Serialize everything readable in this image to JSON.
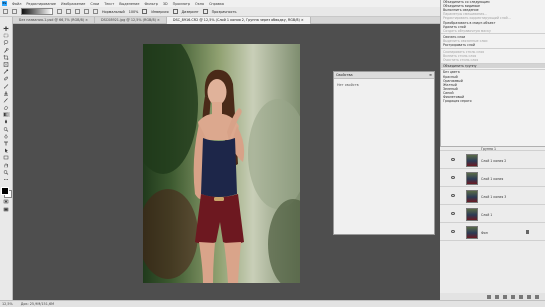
{
  "app": {
    "logo": "Ps"
  },
  "menubar": [
    "Файл",
    "Редактирование",
    "Изображение",
    "Слои",
    "Текст",
    "Выделение",
    "Фильтр",
    "3D",
    "Просмотр",
    "Окно",
    "Справка"
  ],
  "options": {
    "mode": "Нормальный",
    "opacity": "100%",
    "reverse": "Инверсия",
    "dither": "Дизеринг",
    "transparency": "Прозрачность"
  },
  "tabs": [
    {
      "label": "Без названия-1.psd @ 66,7% (RGB/8) ×"
    },
    {
      "label": "DSC08921.jpg @ 12,5% (RGB/8) ×"
    },
    {
      "label": "DSC_8916.CR2 @ 12,5% (Слой 1 копия 2, Группа через обводку, RGB/8) ×"
    }
  ],
  "properties": {
    "title": "Свойства",
    "body": "Нет свойств"
  },
  "menu": {
    "items": [
      {
        "label": "Объединить со следующим",
        "disabled": false
      },
      {
        "label": "Объединить видимые",
        "disabled": false
      },
      {
        "label": "Выполнить сведение",
        "disabled": false
      },
      {
        "label": "Параметры смешивания…",
        "disabled": true
      },
      {
        "label": "Редактировать корректирующий слой…",
        "disabled": true
      },
      {
        "label": "Преобразовать в смарт-объект",
        "disabled": false
      },
      {
        "label": "Удалить слой",
        "disabled": false
      },
      {
        "label": "Создать обтравочную маску",
        "disabled": true
      },
      {
        "label": "Связать слои",
        "disabled": false
      },
      {
        "label": "Выделить связанные слои",
        "disabled": true
      },
      {
        "label": "Растрировать слой",
        "disabled": false
      },
      {
        "label": "Скопировать стиль слоя",
        "disabled": true
      },
      {
        "label": "Вклеить стиль слоя",
        "disabled": true
      },
      {
        "label": "Очистить стиль слоя",
        "disabled": true
      },
      {
        "label": "Объединить группу",
        "disabled": false
      },
      {
        "label": "Без цвета",
        "disabled": false
      },
      {
        "label": "Красный",
        "disabled": false
      },
      {
        "label": "Оранжевый",
        "disabled": false
      },
      {
        "label": "Желтый",
        "disabled": false
      },
      {
        "label": "Зеленый",
        "disabled": false
      },
      {
        "label": "Синий",
        "disabled": false
      },
      {
        "label": "Фиолетовый",
        "disabled": false
      },
      {
        "label": "Градация серого",
        "disabled": false
      }
    ]
  },
  "layers": [
    {
      "name": "Группа 1"
    },
    {
      "name": "Слой 1 копия 2"
    },
    {
      "name": "Слой 1 копия"
    },
    {
      "name": "Слой 1 копия 3"
    },
    {
      "name": "Слой 1"
    },
    {
      "name": "Фон"
    }
  ],
  "status": {
    "zoom": "12,5%",
    "doc": "Док: 25,9M/151,6M"
  }
}
